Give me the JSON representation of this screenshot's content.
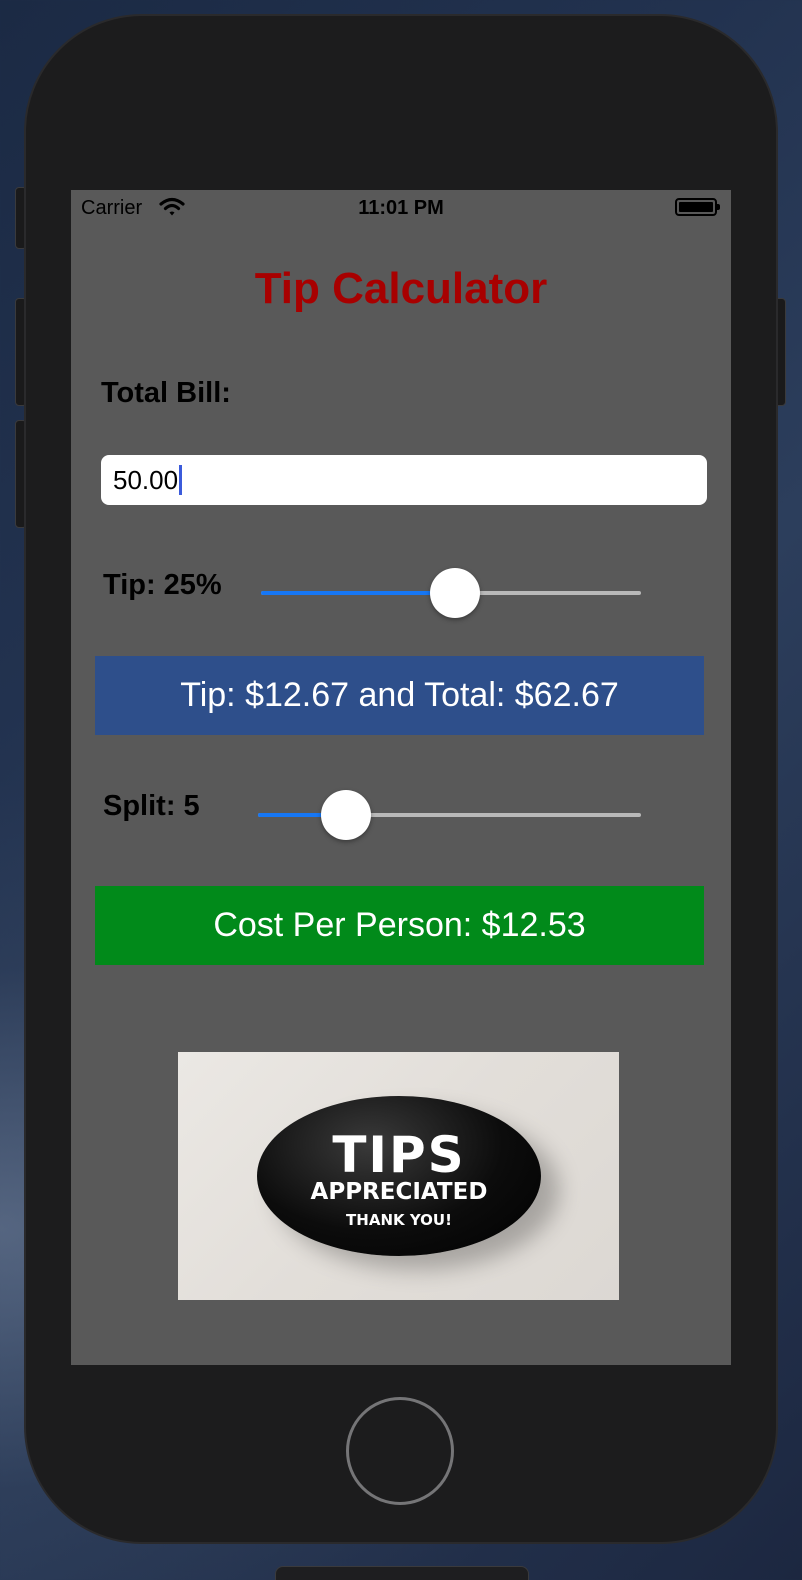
{
  "status_bar": {
    "carrier": "Carrier",
    "time": "11:01 PM"
  },
  "app": {
    "title": "Tip Calculator",
    "bill_label": "Total Bill:",
    "bill_value": "50.00",
    "tip_label": "Tip: 25%",
    "tip_slider_value": 0.51,
    "tip_result": "Tip: $12.67 and Total: $62.67",
    "split_label": "Split: 5",
    "split_slider_value": 0.23,
    "cost_per_person": "Cost Per Person: $12.53",
    "image": {
      "line1": "TIPS",
      "line2": "APPRECIATED",
      "line3": "THANK YOU!"
    }
  },
  "colors": {
    "title": "#a80000",
    "screen_bg": "#595959",
    "tip_result_bg": "#2e4f8b",
    "split_result_bg": "#018a1a",
    "slider_fill": "#1677f5"
  },
  "icons": {
    "wifi": "wifi-icon",
    "battery": "battery-icon"
  }
}
